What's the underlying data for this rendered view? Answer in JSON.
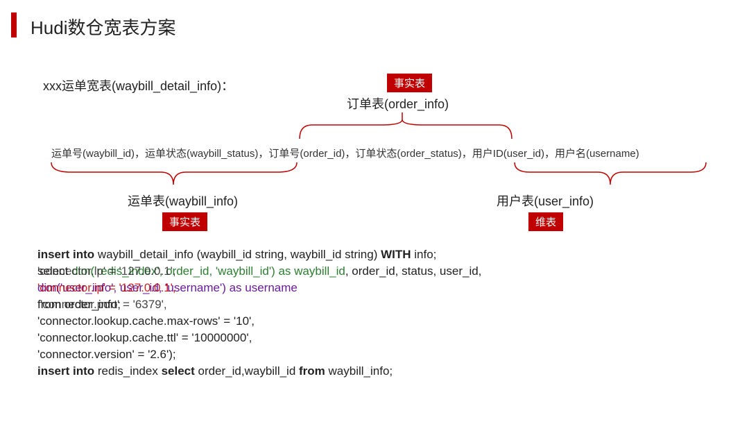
{
  "title": "Hudi数仓宽表方案",
  "intro": "xxx运单宽表(waybill_detail_info)：",
  "fact_top_badge": "事实表",
  "fact_top": "订单表(order_info)",
  "fact_left_badge": "事实表",
  "fact_left": "运单表(waybill_info)",
  "fact_right_badge": "维表",
  "fact_right": "用户表(user_info)",
  "fields": "运单号(waybill_id)，运单状态(waybill_status)，订单号(order_id)，订单状态(order_status)，用户ID(user_id)，用户名(username)",
  "code": {
    "l1_a": "insert into",
    "l1_b": " waybill_detail_info (waybill_id string, waybill_id string) ",
    "l1_c": "WITH",
    "l1_d": " info;",
    "l2_a": "select ",
    "l2_b": "dim('redis_index', order_id, 'waybill_id') as waybill_id",
    "l2_c": ", order_id, status, user_id,",
    "l3_a": "dim('user_info', user_id, 'username') as username",
    "l3_b": "'connector.ip' = '127.0.0.1',",
    "l4_a": "from order_info;",
    "l4_b": "'connector.port' = '6379',",
    "l5": "  'connector.lookup.cache.max-rows' = '10',",
    "l6": "  'connector.lookup.cache.ttl' = '10000000',",
    "l7": "  'connector.version' = '2.6');",
    "l8_a": "insert into",
    "l8_b": " redis_index ",
    "l8_c": "select",
    "l8_d": " order_id,waybill_id ",
    "l8_e": " from",
    "l8_f": " waybill_info;"
  }
}
